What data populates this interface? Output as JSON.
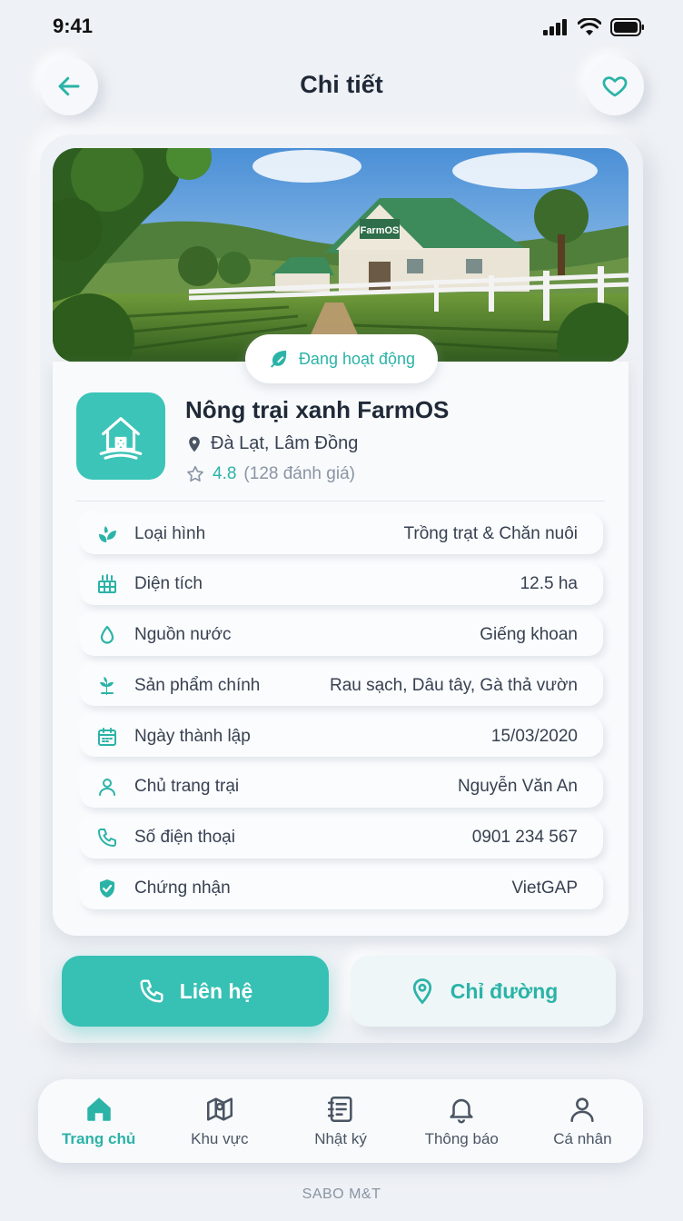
{
  "status_bar": {
    "time": "9:41"
  },
  "header": {
    "title": "Chi tiết",
    "back_icon": "arrow-left-icon",
    "favorite_icon": "heart-icon"
  },
  "farm": {
    "status": "Đang hoạt động",
    "name": "Nông trại xanh FarmOS",
    "location": "Đà Lạt, Lâm Đồng",
    "rating": "4.8",
    "rating_count": "(128 đánh giá)",
    "signboard": "FarmOS"
  },
  "details": [
    {
      "icon": "leaf-icon",
      "label": "Loại hình",
      "value": "Trồng trạt & Chăn nuôi"
    },
    {
      "icon": "area-icon",
      "label": "Diện tích",
      "value": "12.5 ha"
    },
    {
      "icon": "water-drop-icon",
      "label": "Nguồn nước",
      "value": "Giếng khoan"
    },
    {
      "icon": "sprout-icon",
      "label": "Sản phẩm chính",
      "value": "Rau sạch, Dâu tây, Gà thả vườn"
    },
    {
      "icon": "calendar-icon",
      "label": "Ngày thành lập",
      "value": "15/03/2020"
    },
    {
      "icon": "user-icon",
      "label": "Chủ trang trại",
      "value": "Nguyễn Văn An"
    },
    {
      "icon": "phone-icon",
      "label": "Số điện thoại",
      "value": "0901 234 567"
    },
    {
      "icon": "shield-check-icon",
      "label": "Chứng nhận",
      "value": "VietGAP"
    }
  ],
  "actions": {
    "contact": "Liên hệ",
    "directions": "Chỉ đường"
  },
  "nav": [
    {
      "icon": "home-icon",
      "label": "Trang chủ",
      "active": true
    },
    {
      "icon": "map-icon",
      "label": "Khu vực",
      "active": false
    },
    {
      "icon": "journal-icon",
      "label": "Nhật ký",
      "active": false
    },
    {
      "icon": "bell-icon",
      "label": "Thông báo",
      "active": false
    },
    {
      "icon": "profile-icon",
      "label": "Cá nhân",
      "active": false
    }
  ],
  "footer": "SABO M&T",
  "colors": {
    "accent": "#37c0b4",
    "accent_text": "#2bb3a7",
    "background": "#eef1f5"
  }
}
